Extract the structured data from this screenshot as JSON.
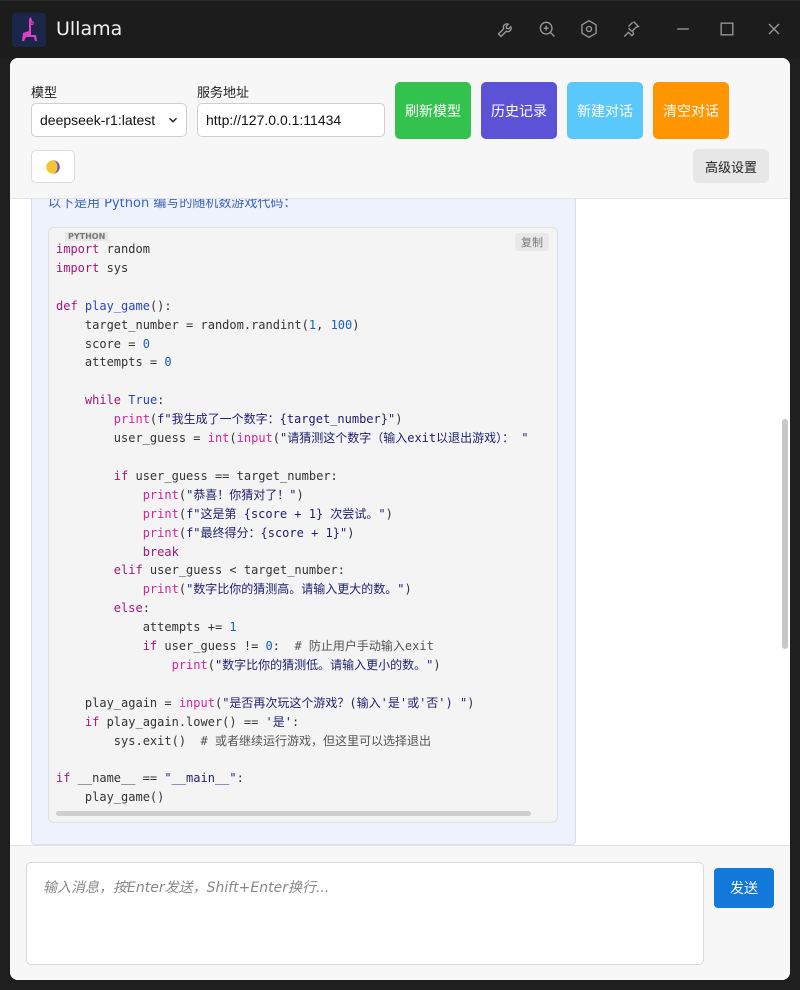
{
  "app": {
    "title": "Ullama"
  },
  "titlebar_icons": [
    "wrench-icon",
    "zoom-in-icon",
    "settings-hex-icon",
    "pin-icon",
    "minimize-icon",
    "maximize-icon",
    "close-icon"
  ],
  "toolbar": {
    "model_label": "模型",
    "model_value": "deepseek-r1:latest",
    "server_label": "服务地址",
    "server_value": "http://127.0.0.1:11434",
    "buttons": {
      "refresh": "刷新模型",
      "history": "历史记录",
      "new_chat": "新建对话",
      "clear": "清空对话"
    },
    "advanced": "高级设置",
    "theme_icon": "moon-icon"
  },
  "colors": {
    "refresh": "#33c24d",
    "history": "#5b52d6",
    "new_chat": "#5ac8fa",
    "clear": "#ff9500",
    "send": "#1278d9"
  },
  "message": {
    "intro": "以下是用 Python 编写的随机数游戏代码：",
    "code": {
      "language": "PYTHON",
      "copy_label": "复制",
      "lines": [
        "import random",
        "import sys",
        "",
        "def play_game():",
        "    target_number = random.randint(1, 100)",
        "    score = 0",
        "    attempts = 0",
        "",
        "    while True:",
        "        print(f\"我生成了一个数字：{target_number}\")",
        "        user_guess = int(input(\"请猜测这个数字（输入exit以退出游戏）： \"",
        "",
        "        if user_guess == target_number:",
        "            print(\"恭喜！你猜对了！\")",
        "            print(f\"这是第 {score + 1} 次尝试。\")",
        "            print(f\"最终得分：{score + 1}\")",
        "            break",
        "        elif user_guess < target_number:",
        "            print(\"数字比你的猜测高。请输入更大的数。\")",
        "        else:",
        "            attempts += 1",
        "            if user_guess != 0:  # 防止用户手动输入exit",
        "                print(\"数字比你的猜测低。请输入更小的数。\")",
        "",
        "    play_again = input(\"是否再次玩这个游戏？(输入'是'或'否') \")",
        "    if play_again.lower() == '是':",
        "        sys.exit()  # 或者继续运行游戏，但这里可以选择退出",
        "",
        "if __name__ == \"__main__\":",
        "    play_game()"
      ]
    }
  },
  "input": {
    "placeholder": "输入消息，按Enter发送，Shift+Enter换行...",
    "send_label": "发送"
  }
}
